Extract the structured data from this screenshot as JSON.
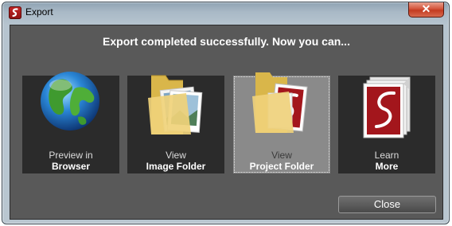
{
  "window": {
    "title": "Export",
    "close_glyph": "✕"
  },
  "headline": "Export completed successfully. Now you can...",
  "tiles": [
    {
      "line1": "Preview in",
      "line2": "Browser",
      "icon": "globe-icon"
    },
    {
      "line1": "View",
      "line2": "Image Folder",
      "icon": "image-folder-icon"
    },
    {
      "line1": "View",
      "line2": "Project Folder",
      "icon": "project-folder-icon",
      "selected": true
    },
    {
      "line1": "Learn",
      "line2": "More",
      "icon": "documents-icon"
    }
  ],
  "close_button": "Close",
  "colors": {
    "client_bg": "#595959",
    "tile_bg": "#2b2b2b",
    "tile_selected_bg": "#8a8a8a",
    "accent_red": "#a3161c"
  }
}
